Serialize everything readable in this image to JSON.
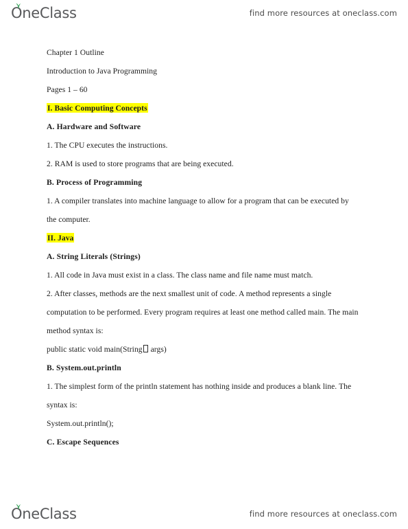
{
  "brand": {
    "logo_name": "OneClass",
    "logo_first_letter": "O",
    "logo_rest": "neClass",
    "promo_text": "find more resources at oneclass.com",
    "leaf_color": "#2e9e52",
    "logo_color": "#58595b"
  },
  "document": {
    "highlight_color": "#ffff00",
    "lines": [
      {
        "id": "title",
        "text": "Chapter 1 Outline",
        "style": "normal"
      },
      {
        "id": "subtitle",
        "text": "Introduction to Java Programming",
        "style": "normal"
      },
      {
        "id": "pages",
        "text": "Pages 1 – 60",
        "style": "normal"
      },
      {
        "id": "section-1",
        "text": "I. Basic Computing Concepts",
        "style": "highlight"
      },
      {
        "id": "heading-1a",
        "text": "A. Hardware and Software",
        "style": "bold"
      },
      {
        "id": "item-1a-1",
        "text": "1. The CPU executes the instructions.",
        "style": "normal"
      },
      {
        "id": "item-1a-2",
        "text": "2. RAM is used to store programs that are being executed.",
        "style": "normal"
      },
      {
        "id": "heading-1b",
        "text": "B. Process of Programming",
        "style": "bold"
      },
      {
        "id": "item-1b-1",
        "text": "1. A compiler translates into machine language to allow for a program that can be executed by",
        "style": "normal"
      },
      {
        "id": "item-1b-1-cont",
        "text": "the computer.",
        "style": "normal"
      },
      {
        "id": "section-2",
        "text": "II. Java",
        "style": "highlight"
      },
      {
        "id": "heading-2a",
        "text": "A. String Literals (Strings)",
        "style": "bold"
      },
      {
        "id": "item-2a-1",
        "text": "1. All code in Java must exist in a class. The class name and file name must match.",
        "style": "normal"
      },
      {
        "id": "item-2a-2",
        "text": "2. After classes, methods are the next smallest unit of code. A method represents a single",
        "style": "normal"
      },
      {
        "id": "item-2a-2-cont1",
        "text": "computation to be performed. Every program requires at least one method called main. The main",
        "style": "normal"
      },
      {
        "id": "item-2a-2-cont2",
        "text": "method syntax is:",
        "style": "normal"
      },
      {
        "id": "code-main",
        "text": "public static void main(String[] args)",
        "style": "code-main"
      },
      {
        "id": "heading-2b",
        "text": "B. System.out.println",
        "style": "bold"
      },
      {
        "id": "item-2b-1",
        "text": "1. The simplest form of the println statement has nothing inside and produces a blank line. The",
        "style": "normal"
      },
      {
        "id": "item-2b-1-cont",
        "text": "syntax is:",
        "style": "normal"
      },
      {
        "id": "code-println",
        "text": "System.out.println();",
        "style": "normal"
      },
      {
        "id": "heading-2c",
        "text": "C. Escape Sequences",
        "style": "bold"
      }
    ],
    "code_main_parts": {
      "before": "public static void main(String",
      "after": " args)"
    }
  }
}
